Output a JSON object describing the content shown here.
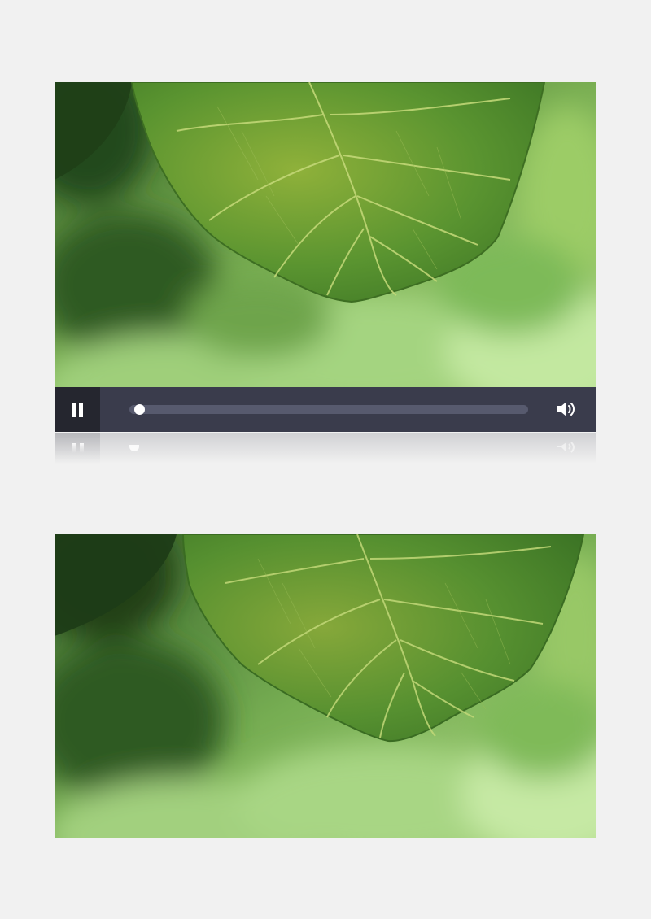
{
  "player": {
    "state": "playing",
    "progress_fraction": 0.0,
    "controls_color": "#3a3c4c",
    "play_button_color": "#25262f"
  },
  "icons": {
    "play_pause": "pause-icon",
    "volume": "volume-icon"
  },
  "colors": {
    "background": "#f1f1f1",
    "leaf_green": "#4e8a2a",
    "foliage_light": "#b6de8e"
  }
}
